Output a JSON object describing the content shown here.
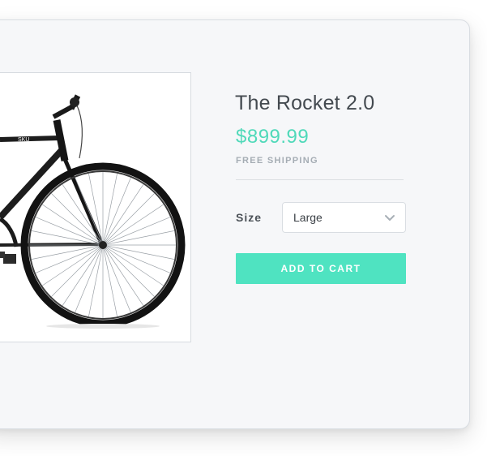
{
  "product": {
    "title": "The Rocket 2.0",
    "price": "$899.99",
    "shipping_note": "FREE SHIPPING",
    "image_icon": "bicycle-image",
    "frame_decal": "SKU"
  },
  "options": {
    "size_label": "Size",
    "size_value": "Large",
    "chevron_icon": "chevron-down-icon"
  },
  "actions": {
    "add_to_cart_label": "ADD TO CART"
  },
  "colors": {
    "accent": "#4fe3c1",
    "price": "#4fd9b9",
    "card_background": "#f6f7f9",
    "muted_text": "#a5adb4"
  }
}
